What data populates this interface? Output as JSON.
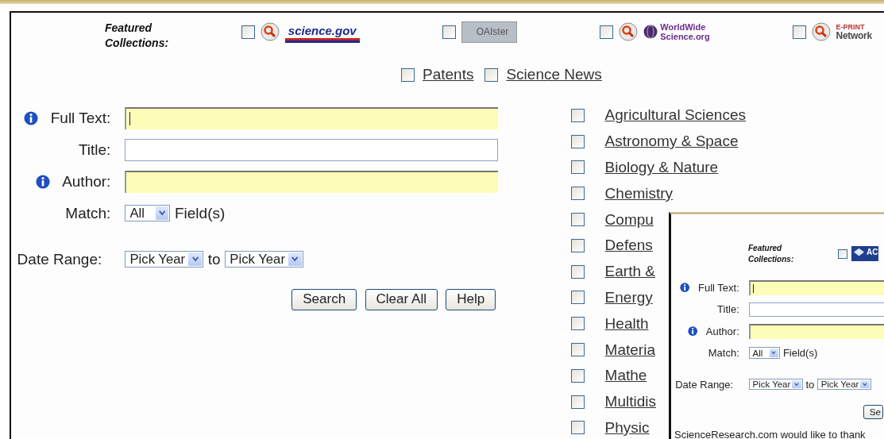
{
  "featured": {
    "label": "Featured Collections:",
    "collections": [
      {
        "kind": "underlined",
        "lines": [
          "science.gov"
        ],
        "checked": false,
        "search_icon": true
      },
      {
        "kind": "boxed",
        "lines": [
          "OAIster"
        ],
        "checked": false,
        "search_icon": false
      },
      {
        "kind": "globe",
        "lines": [
          "WorldWide",
          "Science.org"
        ],
        "checked": false,
        "search_icon": true
      },
      {
        "kind": "stacked",
        "lines": [
          "E-PRINT",
          "Network"
        ],
        "checked": false,
        "search_icon": true
      }
    ]
  },
  "links": [
    {
      "label": "Patents",
      "checked": false
    },
    {
      "label": "Science News",
      "checked": false
    }
  ],
  "form": {
    "fields": [
      {
        "label": "Full Text:",
        "info": true,
        "highlighted": true,
        "focused": true
      },
      {
        "label": "Title:",
        "info": false,
        "highlighted": false,
        "focused": false
      },
      {
        "label": "Author:",
        "info": true,
        "highlighted": true,
        "focused": false
      }
    ],
    "match": {
      "label": "Match:",
      "value": "All",
      "suffix": "Field(s)"
    },
    "date_range": {
      "label": "Date Range:",
      "from": "Pick Year",
      "joiner": "to",
      "to": "Pick Year"
    },
    "buttons": [
      "Search",
      "Clear All",
      "Help"
    ]
  },
  "categories": [
    {
      "label": "Agricultural Sciences",
      "checked": false
    },
    {
      "label": "Astronomy & Space",
      "checked": false
    },
    {
      "label": "Biology & Nature",
      "checked": false
    },
    {
      "label": "Chemistry",
      "checked": false
    },
    {
      "label": "Compu",
      "checked": false
    },
    {
      "label": "Defens",
      "checked": false
    },
    {
      "label": "Earth &",
      "checked": false
    },
    {
      "label": "Energy",
      "checked": false
    },
    {
      "label": "Health",
      "checked": false
    },
    {
      "label": "Materia",
      "checked": false
    },
    {
      "label": "Mathe",
      "checked": false
    },
    {
      "label": "Multidis",
      "checked": false
    },
    {
      "label": "Physic",
      "checked": false
    }
  ],
  "overlay": {
    "featured_label": "Featured Collections:",
    "collection": {
      "lines": [
        "AC"
      ],
      "checked": false
    },
    "form": {
      "fields": [
        {
          "label": "Full Text:",
          "info": true,
          "highlighted": true,
          "focused": true
        },
        {
          "label": "Title:",
          "info": false,
          "highlighted": false,
          "focused": false
        },
        {
          "label": "Author:",
          "info": true,
          "highlighted": true,
          "focused": false
        }
      ],
      "match": {
        "label": "Match:",
        "value": "All",
        "suffix": "Field(s)"
      },
      "date_range": {
        "label": "Date Range:",
        "from": "Pick Year",
        "joiner": "to",
        "to": "Pick Year"
      },
      "buttons": [
        "Se"
      ]
    },
    "note": "ScienceResearch.com would like to thank"
  }
}
